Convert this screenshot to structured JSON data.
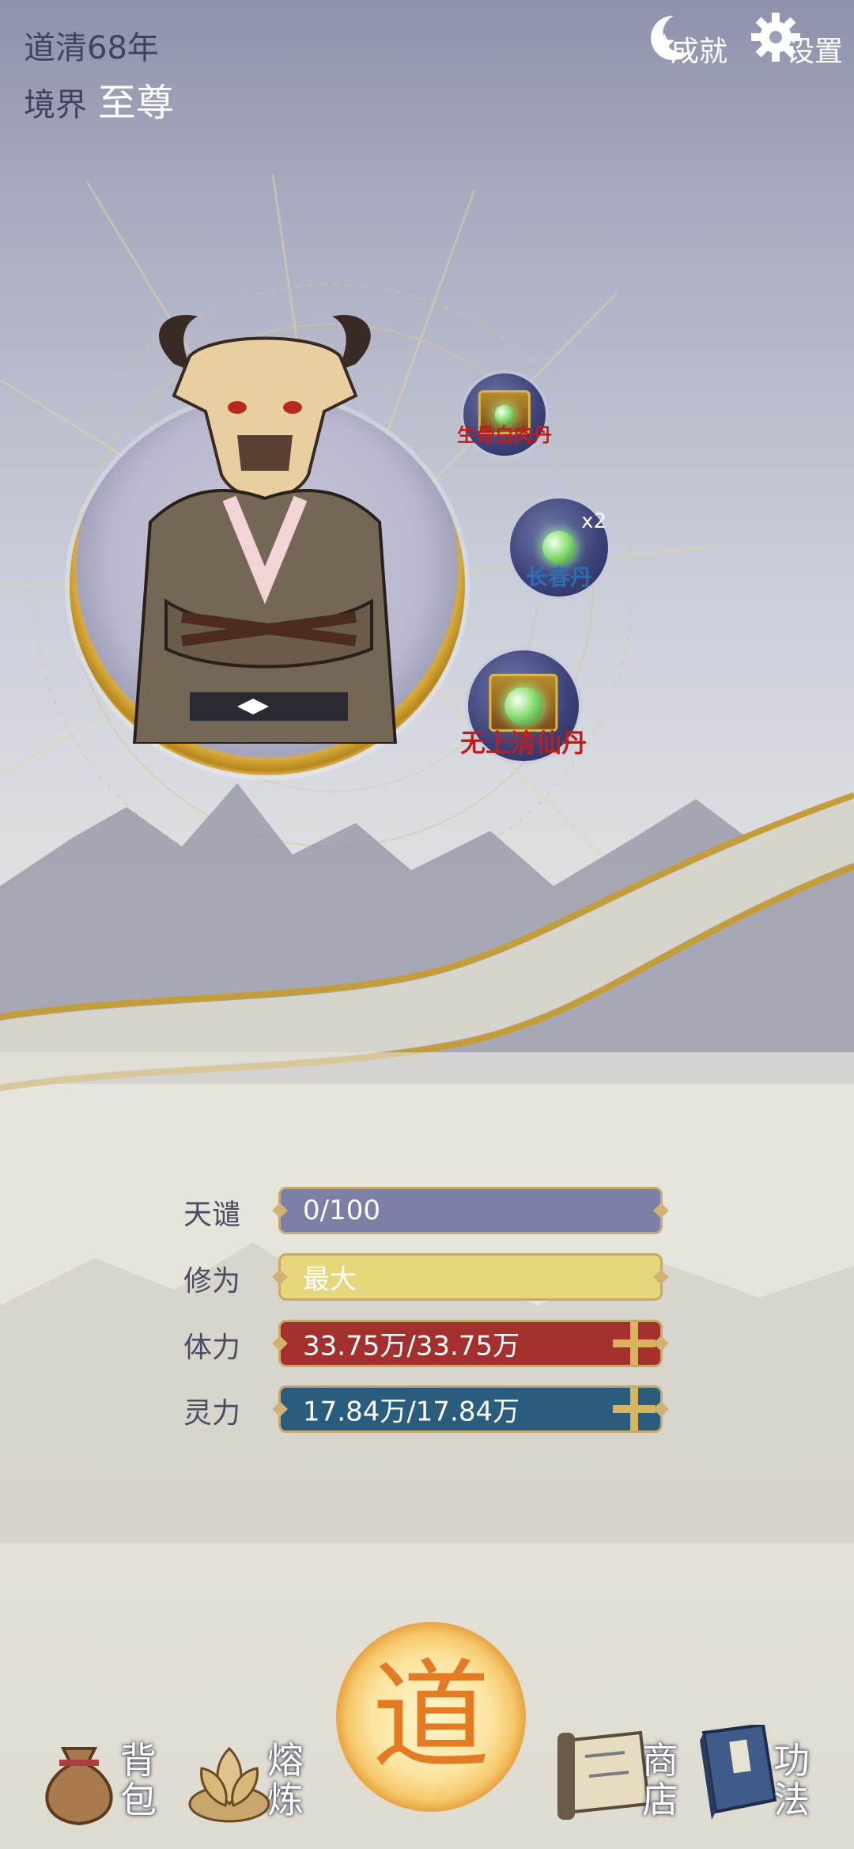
{
  "header": {
    "year": "道清68年",
    "realm_label": "境界",
    "realm_value": "至尊",
    "achievements_label": "成就",
    "settings_label": "设置"
  },
  "items": [
    {
      "name": "生骨白肉丹",
      "quantity": ""
    },
    {
      "name": "长春丹",
      "quantity": "x2"
    },
    {
      "name": "无上清仙丹",
      "quantity": ""
    }
  ],
  "stats": {
    "tianqian": {
      "label": "天谴",
      "value": "0/100",
      "color": "#7c7fa6"
    },
    "xiuwei": {
      "label": "修为",
      "value": "最大",
      "color": "#e6d77b"
    },
    "tili": {
      "label": "体力",
      "value": "33.75万/33.75万",
      "color": "#a3302c"
    },
    "lingli": {
      "label": "灵力",
      "value": "17.84万/17.84万",
      "color": "#2a5c7e"
    }
  },
  "nav": {
    "bag": "背包",
    "smelt": "熔炼",
    "dao": "道",
    "shop": "商店",
    "skills": "功法"
  }
}
